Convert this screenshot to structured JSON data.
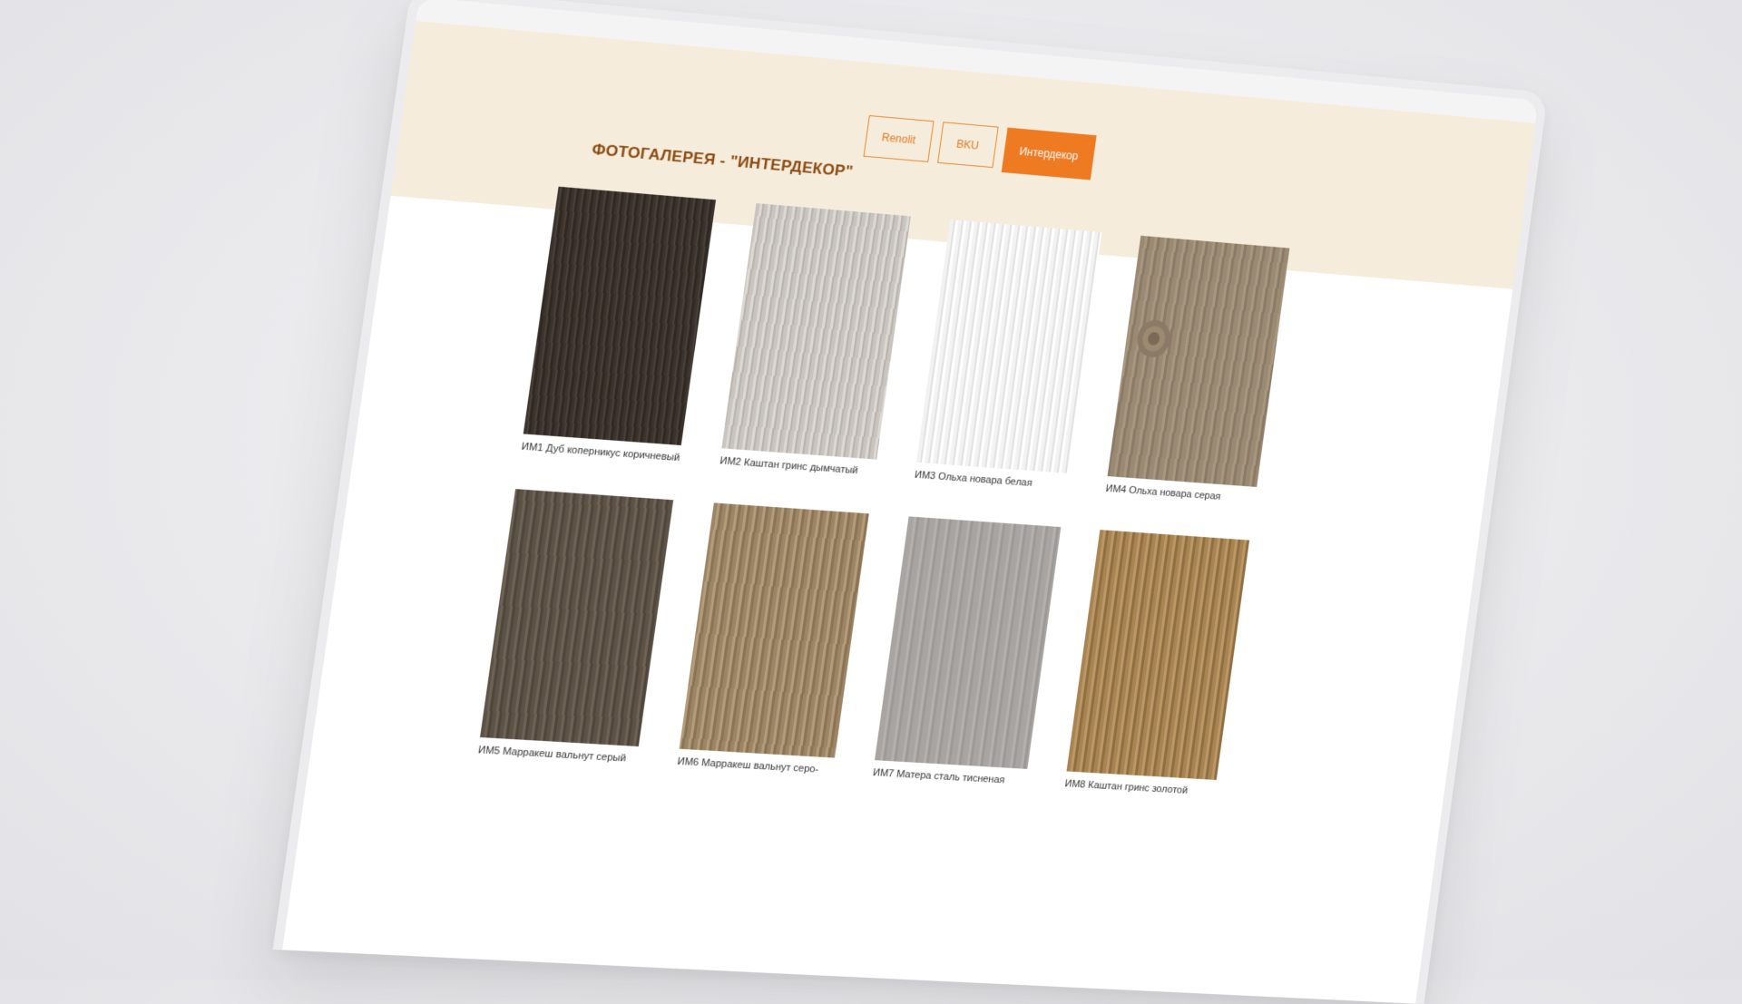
{
  "tabs": [
    {
      "label": "Renolit"
    },
    {
      "label": "BKU"
    },
    {
      "label": "Интердекор"
    }
  ],
  "gallery": {
    "title": "ФОТОГАЛЕРЕЯ - \"ИНТЕРДЕКОР\"",
    "items": [
      {
        "caption": "ИМ1 Дуб коперникус коричневый"
      },
      {
        "caption": "ИМ2 Каштан гринс дымчатый"
      },
      {
        "caption": "ИМ3 Ольха новара белая"
      },
      {
        "caption": "ИМ4 Ольха новара серая"
      },
      {
        "caption": "ИМ5 Марракеш вальнут серый"
      },
      {
        "caption": "ИМ6 Марракеш вальнут серо-"
      },
      {
        "caption": "ИМ7 Матера сталь тисненая"
      },
      {
        "caption": "ИМ8 Каштан гринс золотой"
      }
    ]
  },
  "colors": {
    "accent": "#ee7a22",
    "hero_bg": "#f6ecdc",
    "title": "#8a4b10"
  }
}
